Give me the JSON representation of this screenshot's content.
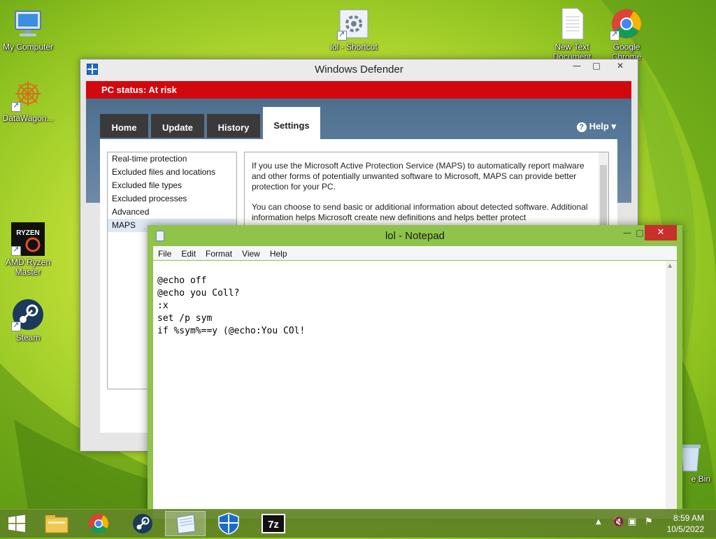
{
  "desktop": {
    "icons": [
      {
        "label": "My Computer"
      },
      {
        "label": "DataWagon..."
      },
      {
        "label": "AMD Ryzen Master"
      },
      {
        "label": "Steam"
      },
      {
        "label": "lol - Shortcut"
      },
      {
        "label": "New Text Document"
      },
      {
        "label": "Google Chrome"
      },
      {
        "label": "e Bin"
      }
    ]
  },
  "defender": {
    "title": "Windows Defender",
    "status": "PC status: At risk",
    "status_color": "#d1090f",
    "tabs": [
      {
        "label": "Home"
      },
      {
        "label": "Update"
      },
      {
        "label": "History"
      },
      {
        "label": "Settings"
      }
    ],
    "active_tab": "Settings",
    "help_label": "Help",
    "settings_list": [
      {
        "label": "Real-time protection"
      },
      {
        "label": "Excluded files and locations"
      },
      {
        "label": "Excluded file types"
      },
      {
        "label": "Excluded processes"
      },
      {
        "label": "Advanced"
      },
      {
        "label": "MAPS"
      }
    ],
    "selected_item": "MAPS",
    "content": [
      "If you use the Microsoft Active Protection Service (MAPS) to automatically report malware and other forms of potentially unwanted software to Microsoft, MAPS can provide better protection for your PC.",
      "You can choose to send basic or additional information about detected software. Additional information helps Microsoft create new definitions and helps better protect"
    ]
  },
  "notepad": {
    "title": "lol - Notepad",
    "menu": [
      "File",
      "Edit",
      "Format",
      "View",
      "Help"
    ],
    "lines": [
      "@echo off",
      "@echo you Coll?",
      ":x",
      "set /p sym",
      "if %sym%==y (@echo:You COl!"
    ],
    "frame_color": "#8fc34a"
  },
  "taskbar": {
    "items": [
      {
        "icon": "windows-start-icon"
      },
      {
        "icon": "file-explorer-icon"
      },
      {
        "icon": "chrome-icon"
      },
      {
        "icon": "steam-icon"
      },
      {
        "icon": "notepad-icon",
        "active": true
      },
      {
        "icon": "windows-defender-icon"
      },
      {
        "icon": "7zip-icon",
        "text": "7z"
      }
    ],
    "time": "8:59 AM",
    "date": "10/5/2022"
  }
}
